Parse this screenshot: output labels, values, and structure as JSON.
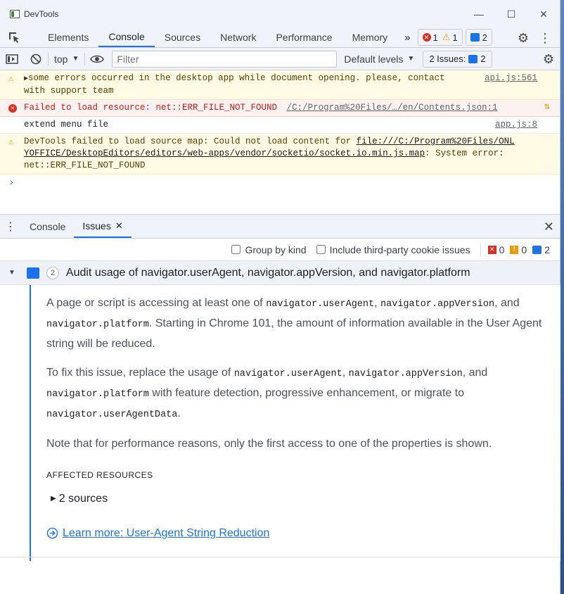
{
  "window": {
    "title": "DevTools"
  },
  "tabs": [
    "Elements",
    "Console",
    "Sources",
    "Network",
    "Performance",
    "Memory"
  ],
  "active_tab": "Console",
  "counts": {
    "errors": "1",
    "warnings": "1",
    "info": "2"
  },
  "filterbar": {
    "context": "top",
    "filter_placeholder": "Filter",
    "levels": "Default levels",
    "issues_label": "2 Issues:",
    "issues_count": "2"
  },
  "console": {
    "m1": {
      "text_a": "some errors occurred in the desktop app while document opening. please, contact",
      "text_b": "with support team",
      "source": "api.js:561"
    },
    "m2": {
      "text": "Failed to load resource: net::ERR_FILE_NOT_FOUND",
      "source": "/C:/Program%20Files/…/en/Contents.json:1"
    },
    "m3": {
      "text": "extend menu file",
      "source": "app.js:8"
    },
    "m4": {
      "text_a": "DevTools failed to load source map: Could not load content for",
      "link_a": "file:///C:/Program%20Files/ONL",
      "link_b": "YOFFICE/DesktopEditors/editors/web-apps/vendor/socketio/socket.io.min.js.map",
      "text_b": ": System error:",
      "text_c": "net::ERR_FILE_NOT_FOUND"
    }
  },
  "drawer": {
    "tab_console": "Console",
    "tab_issues": "Issues"
  },
  "issues_toolbar": {
    "group_by_kind": "Group by kind",
    "third_party": "Include third-party cookie issues",
    "err": "0",
    "warn": "0",
    "info": "2"
  },
  "issue": {
    "count": "2",
    "title": "Audit usage of navigator.userAgent, navigator.appVersion, and navigator.platform",
    "p1_a": "A page or script is accessing at least one of",
    "p1_c1": "navigator.userAgent",
    "p1_b": ",",
    "p1_c2": "navigator.appVersion",
    "p1_c": ", and",
    "p1_c3": "navigator.platform",
    "p1_d": ". Starting in Chrome 101, the amount of information available in the User Agent string will be reduced.",
    "p2_a": "To fix this issue, replace the usage of",
    "p2_c1": "navigator.userAgent",
    "p2_b": ",",
    "p2_c2": "navigator.appVersion",
    "p2_c": ", and",
    "p2_c3": "navigator.platform",
    "p2_d": "with feature detection, progressive enhancement, or migrate to",
    "p2_c4": "navigator.userAgentData",
    "p2_e": ".",
    "p3": "Note that for performance reasons, only the first access to one of the properties is shown.",
    "affected_title": "AFFECTED RESOURCES",
    "sources": "2 sources",
    "learn_more": "Learn more: User-Agent String Reduction"
  }
}
